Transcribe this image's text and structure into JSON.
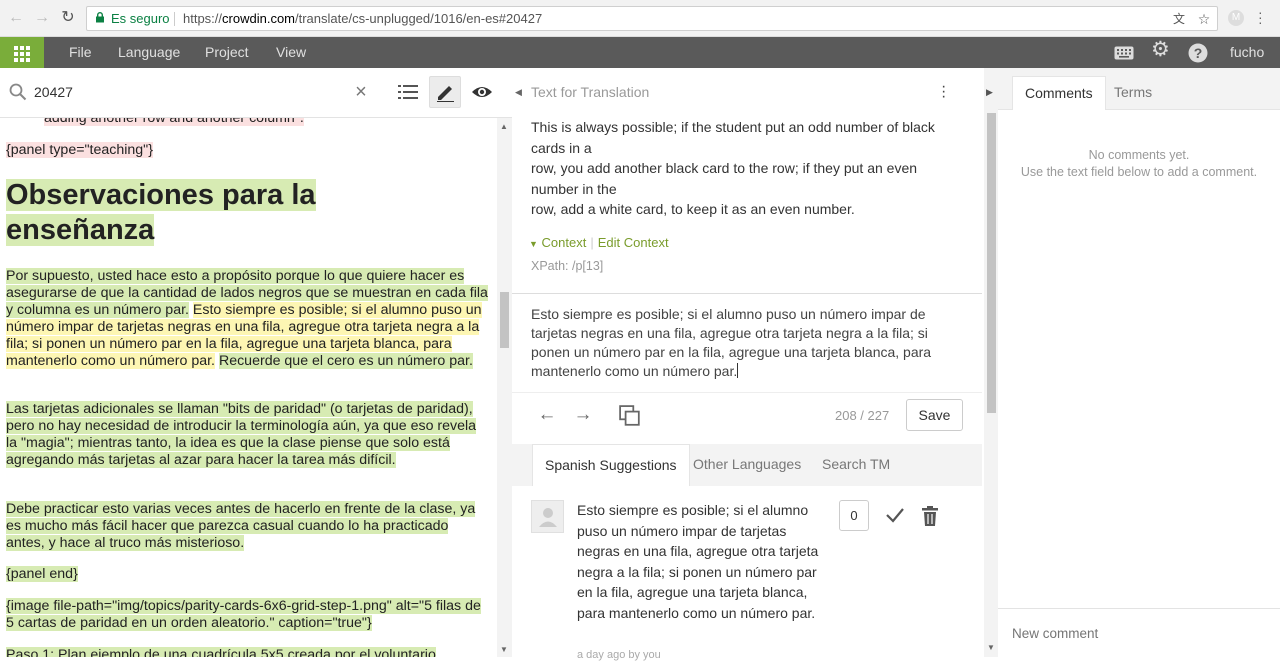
{
  "browser": {
    "secure_label": "Es seguro",
    "url_prefix": "https://",
    "url_host": "crowdin.com",
    "url_path": "/translate/cs-unplugged/1016/en-es#20427"
  },
  "appbar": {
    "menu": [
      "File",
      "Language",
      "Project",
      "View"
    ],
    "user": "fucho"
  },
  "left": {
    "search_value": "20427",
    "lines": {
      "cut_top": "adding another row and another column\".",
      "panel_teaching": "{panel type=\"teaching\"}",
      "heading": "Observaciones para la enseñanza",
      "p1_a": "Por supuesto, usted hace esto a propósito porque lo que quiere hacer es asegurarse de que la cantidad de lados negros que se muestran en cada fila y columna es un número par.",
      "p1_b": "Esto siempre es posible; si el alumno puso un número impar de tarjetas negras en una fila, agregue otra tarjeta negra a la fila; si ponen un número par en la fila, agregue una tarjeta blanca, para mantenerlo como un número par.",
      "p1_c": "Recuerde que el cero es un número par.",
      "p2": "Las tarjetas adicionales se llaman \"bits de paridad\" (o tarjetas de paridad), pero no hay necesidad de introducir la terminología aún, ya que eso revela la \"magia\"; mientras tanto, la idea es que la clase piense que solo está agregando más tarjetas al azar para hacer la tarea más difícil.",
      "p3": "Debe practicar esto varias veces antes de hacerlo en frente de la clase, ya es mucho más fácil hacer que parezca casual cuando lo ha practicado antes, y hace al truco más misterioso.",
      "panel_end": "{panel end}",
      "image": "{image file-path=\"img/topics/parity-cards-6x6-grid-step-1.png\" alt=\"5 filas de 5 cartas de paridad en un orden aleatorio.\" caption=\"true\"}",
      "cut_bottom": "Paso 1: Plan ejemplo de una cuadrícula 5x5 creada por el voluntario"
    }
  },
  "middle": {
    "header": "Text for Translation",
    "source_lines": [
      "This is always possible; if the student put an odd number of black cards in a",
      "row, you add another black card to the row; if they put an even number in the",
      "row, add a white card, to keep it as an even number."
    ],
    "context_label": "Context",
    "edit_context_label": "Edit Context",
    "xpath": "XPath: /p[13]",
    "translation": "Esto siempre es posible; si el alumno puso un número impar de tarjetas negras en una fila, agregue otra tarjeta negra a la fila; si ponen un número par en la fila, agregue una tarjeta blanca, para mantenerlo como un número par.",
    "counter": "208 / 227",
    "save_label": "Save",
    "tabs": [
      "Spanish Suggestions",
      "Other Languages",
      "Search TM"
    ],
    "suggestion": {
      "text": "Esto siempre es posible; si el alumno puso un número impar de tarjetas negras en una fila, agregue otra tarjeta negra a la fila; si ponen un número par en la fila, agregue una tarjeta blanca, para mantenerlo como un número par.",
      "votes": "0",
      "meta": "a day ago by you"
    }
  },
  "right": {
    "tabs": [
      "Comments",
      "Terms"
    ],
    "no_comments": "No comments yet.",
    "hint": "Use the text field below to add a comment.",
    "new_comment_placeholder": "New comment"
  },
  "colors": {
    "accent_green": "#7aad3a",
    "appbar": "#5a5a5a",
    "highlight_approved": "#d7ebb3",
    "highlight_current": "#fdf6b3"
  }
}
